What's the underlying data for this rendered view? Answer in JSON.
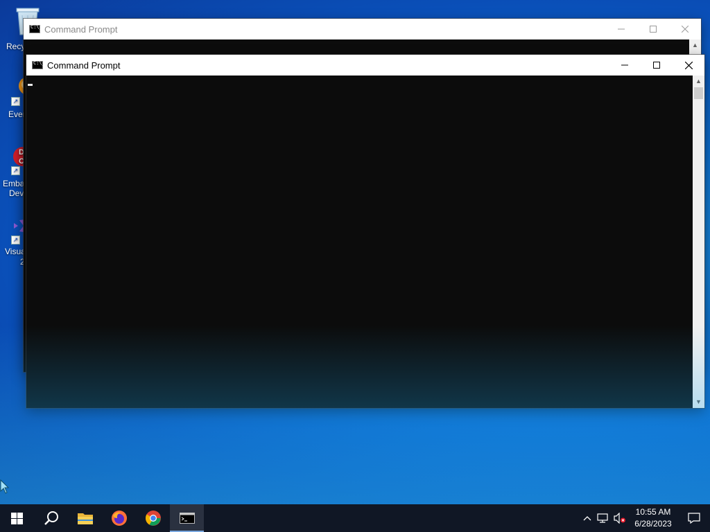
{
  "desktop": {
    "icons": [
      {
        "name": "recycle-bin",
        "label": "Recy"
      },
      {
        "name": "everything",
        "label": "Ever"
      },
      {
        "name": "embarcadero-dev",
        "label1": "Emba",
        "label2": "Dev"
      },
      {
        "name": "visual-studio",
        "label1": "Visua",
        "label2": "2"
      }
    ]
  },
  "back_window": {
    "title": "Command Prompt"
  },
  "front_window": {
    "title": "Command Prompt"
  },
  "taskbar": {
    "apps": [
      "start",
      "search",
      "file-explorer",
      "firefox",
      "chrome",
      "command-prompt"
    ],
    "active": "command-prompt"
  },
  "tray": {
    "time": "10:55 AM",
    "date": "6/28/2023"
  },
  "colors": {
    "console_bg": "#0c0c0c",
    "taskbar_bg": "#101725",
    "desktop_blue": "#0d73d8"
  }
}
